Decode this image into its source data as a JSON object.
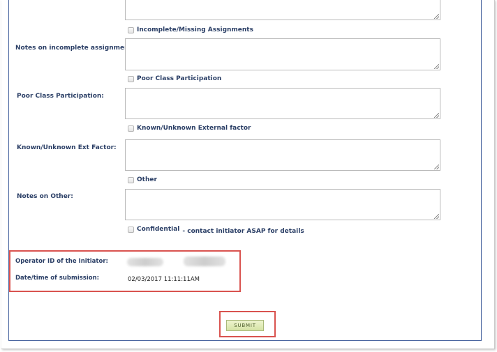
{
  "form": {
    "incomplete_checkbox_label": "Incomplete/Missing Assignments",
    "incomplete_notes_label": "Notes on incomplete assignment:",
    "participation_checkbox_label": "Poor Class Participation",
    "participation_notes_label": "Poor Class Participation:",
    "external_checkbox_label": "Known/Unknown External factor",
    "external_notes_label": "Known/Unknown Ext Factor:",
    "other_checkbox_label": "Other",
    "other_notes_label": "Notes on Other:",
    "confidential_checkbox_label": "Confidential",
    "confidential_suffix": "- contact initiator ASAP for details"
  },
  "initiator": {
    "operator_id_label": "Operator ID of the Initiator:",
    "submission_label": "Date/time of submission:",
    "submission_value": "02/03/2017 11:11:11AM"
  },
  "actions": {
    "submit_label": "SUBMIT"
  },
  "colors": {
    "label_text": "#2b3f66",
    "highlight": "#d9534f",
    "submit_bg": "#d5e3a4"
  }
}
